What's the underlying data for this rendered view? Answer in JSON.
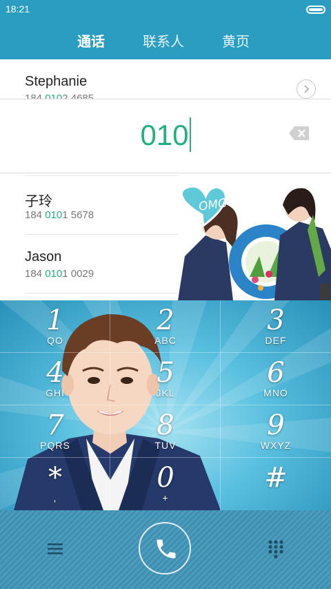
{
  "status_bar": {
    "time": "18:21",
    "battery_icon": "battery-full-icon"
  },
  "tabs": [
    {
      "label": "通话",
      "active": true
    },
    {
      "label": "联系人",
      "active": false
    },
    {
      "label": "黄页",
      "active": false
    }
  ],
  "top_contact": {
    "name": "Stephanie",
    "number_prefix": "184 ",
    "number_match": "010",
    "number_suffix": "2 4685"
  },
  "dial_input": {
    "value": "010",
    "backspace_icon": "backspace-icon"
  },
  "results": [
    {
      "name": "子玲",
      "number_prefix": "184 ",
      "number_match": "010",
      "number_suffix": "1 5678"
    },
    {
      "name": "Jason",
      "number_prefix": "184 ",
      "number_match": "010",
      "number_suffix": "1 0029"
    }
  ],
  "photo_badge": "OMG",
  "keypad": [
    {
      "digit": "1",
      "letters": "QO"
    },
    {
      "digit": "2",
      "letters": "ABC"
    },
    {
      "digit": "3",
      "letters": "DEF"
    },
    {
      "digit": "4",
      "letters": "GHI"
    },
    {
      "digit": "5",
      "letters": "JKL"
    },
    {
      "digit": "6",
      "letters": "MNO"
    },
    {
      "digit": "7",
      "letters": "PQRS"
    },
    {
      "digit": "8",
      "letters": "TUV"
    },
    {
      "digit": "9",
      "letters": "WXYZ"
    },
    {
      "digit": "*",
      "letters": ","
    },
    {
      "digit": "0",
      "letters": "+"
    },
    {
      "digit": "#",
      "letters": ""
    }
  ],
  "bottom_bar": {
    "menu_icon": "menu-icon",
    "call_icon": "phone-icon",
    "dialpad_icon": "dialpad-icon"
  },
  "colors": {
    "header": "#2a9dc0",
    "match_highlight": "#22b07d"
  }
}
